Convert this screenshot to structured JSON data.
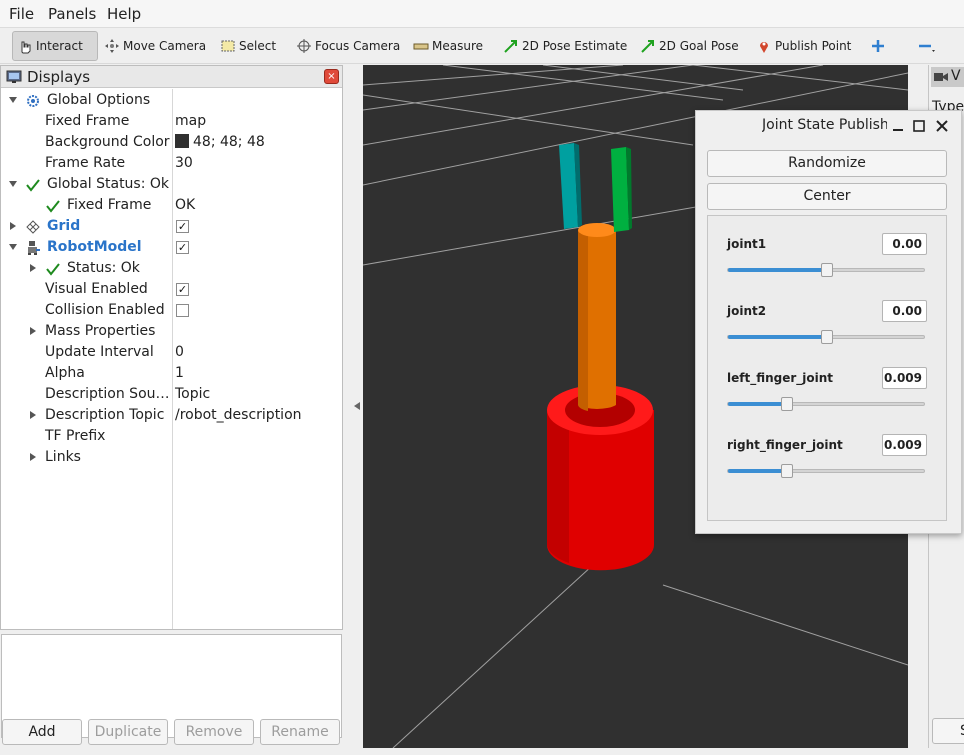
{
  "menu": {
    "file": "File",
    "panels": "Panels",
    "help": "Help"
  },
  "toolbar": {
    "interact": "Interact",
    "move_camera": "Move Camera",
    "select": "Select",
    "focus_camera": "Focus Camera",
    "measure": "Measure",
    "pose_estimate": "2D Pose Estimate",
    "goal_pose": "2D Goal Pose",
    "publish_point": "Publish Point"
  },
  "displays": {
    "title": "Displays",
    "rows": {
      "global_options": "Global Options",
      "fixed_frame_label": "Fixed Frame",
      "fixed_frame_value": "map",
      "background_color_label": "Background Color",
      "background_color_value": "48; 48; 48",
      "frame_rate_label": "Frame Rate",
      "frame_rate_value": "30",
      "global_status": "Global Status: Ok",
      "gs_fixed_frame_label": "Fixed Frame",
      "gs_fixed_frame_value": "OK",
      "grid": "Grid",
      "robot_model": "RobotModel",
      "status_ok": "Status: Ok",
      "visual_enabled": "Visual Enabled",
      "collision_enabled": "Collision Enabled",
      "mass_properties": "Mass Properties",
      "update_interval_label": "Update Interval",
      "update_interval_value": "0",
      "alpha_label": "Alpha",
      "alpha_value": "1",
      "description_source_label": "Description Sou…",
      "description_source_value": "Topic",
      "description_topic_label": "Description Topic",
      "description_topic_value": "/robot_description",
      "tf_prefix": "TF Prefix",
      "links": "Links"
    },
    "buttons": {
      "add": "Add",
      "duplicate": "Duplicate",
      "remove": "Remove",
      "rename": "Rename"
    }
  },
  "right_panel": {
    "tab_label": "V",
    "type_label": "Type",
    "bottom_button": "S"
  },
  "joint_state_publisher": {
    "title": "Joint State Publisher",
    "randomize": "Randomize",
    "center": "Center",
    "joints": [
      {
        "name": "joint1",
        "value": "0.00",
        "slider_fraction": 0.5
      },
      {
        "name": "joint2",
        "value": "0.00",
        "slider_fraction": 0.5
      },
      {
        "name": "left_finger_joint",
        "value": "0.009",
        "slider_fraction": 0.3
      },
      {
        "name": "right_finger_joint",
        "value": "0.009",
        "slider_fraction": 0.3
      }
    ]
  },
  "colors": {
    "background": "#303030",
    "accent": "#3b8ed3",
    "base": "#e00000",
    "arm": "#e07000",
    "finger_left": "#00a0a0",
    "finger_right": "#00b040"
  }
}
